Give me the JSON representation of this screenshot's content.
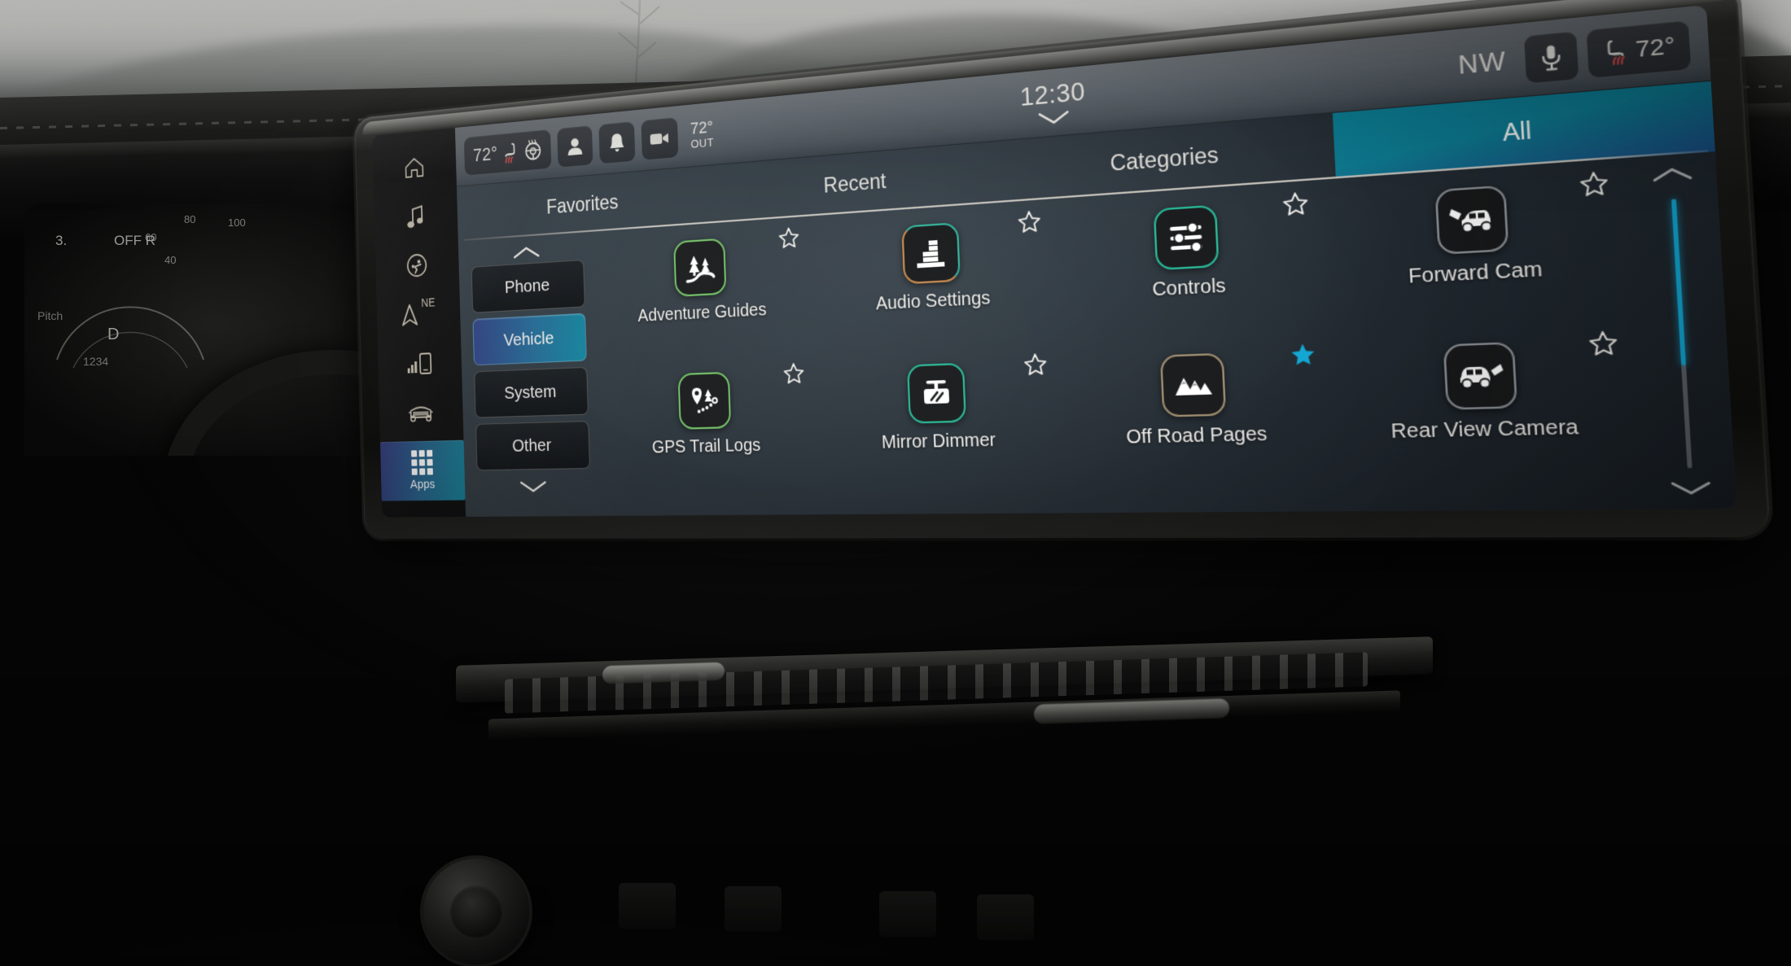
{
  "scene": {
    "description": "Automotive infotainment touchscreen Apps menu, angled view from driver seat",
    "accent_teal": "#0d7e95",
    "accent_cyan": "#12a9d6",
    "accent_blue": "#2e3f83"
  },
  "hardkeys": {
    "items": [
      {
        "name": "home",
        "icon": "home-icon",
        "label": ""
      },
      {
        "name": "media",
        "icon": "music-note-icon",
        "label": ""
      },
      {
        "name": "comfort",
        "icon": "comfort-person-icon",
        "label": ""
      },
      {
        "name": "navigation",
        "icon": "nav-arrow-icon",
        "label": "NE"
      },
      {
        "name": "phone",
        "icon": "phone-signal-icon",
        "label": ""
      },
      {
        "name": "vehicle",
        "icon": "vehicle-front-icon",
        "label": ""
      },
      {
        "name": "apps",
        "icon": "apps-grid-icon",
        "label": "Apps"
      }
    ],
    "selected": "apps"
  },
  "statusbar": {
    "driver_temp": "72°",
    "heated_seat_icon": "heated-seat-icon",
    "heated_wheel_icon": "heated-steering-wheel-icon",
    "profile_icon": "user-profile-icon",
    "notifications_icon": "bell-icon",
    "camera_icon": "camera-icon",
    "outside_temp": "72°",
    "outside_label": "OUT",
    "clock": "12:30",
    "clock_chevron_icon": "chevron-down-icon",
    "heading": "NW",
    "mic_icon": "microphone-icon",
    "passenger_heated_seat_icon": "heated-seat-icon",
    "passenger_temp": "72°"
  },
  "tabs": [
    {
      "label": "Favorites",
      "active": false
    },
    {
      "label": "Recent",
      "active": false
    },
    {
      "label": "Categories",
      "active": false
    },
    {
      "label": "All",
      "active": true
    }
  ],
  "categories": {
    "scroll_up_icon": "chevron-up-icon",
    "scroll_down_icon": "chevron-down-icon",
    "items": [
      {
        "label": "Phone",
        "active": false
      },
      {
        "label": "Vehicle",
        "active": true
      },
      {
        "label": "System",
        "active": false
      },
      {
        "label": "Other",
        "active": false
      }
    ]
  },
  "apps": {
    "rows": [
      [
        {
          "label": "Adventure Guides",
          "icon": "trail-trees-icon",
          "border": "green",
          "favorited": false
        },
        {
          "label": "Audio Settings",
          "icon": "equalizer-bars-icon",
          "border": "orange",
          "favorited": false
        },
        {
          "label": "Controls",
          "icon": "sliders-icon",
          "border": "teal",
          "favorited": false
        },
        {
          "label": "Forward Cam",
          "icon": "forward-camera-truck-icon",
          "border": "gray",
          "favorited": false
        }
      ],
      [
        {
          "label": "GPS Trail Logs",
          "icon": "gps-trail-pin-icon",
          "border": "green",
          "favorited": false
        },
        {
          "label": "Mirror Dimmer",
          "icon": "mirror-dimmer-icon",
          "border": "teal",
          "favorited": false
        },
        {
          "label": "Off Road Pages",
          "icon": "mountains-icon",
          "border": "tan",
          "favorited": true
        },
        {
          "label": "Rear View Camera",
          "icon": "rear-camera-truck-icon",
          "border": "gray",
          "favorited": false
        }
      ]
    ]
  },
  "scrollbar": {
    "up_icon": "chevron-up-icon",
    "down_icon": "chevron-down-icon",
    "thumb_position": "top"
  },
  "cluster": {
    "gear": "3.",
    "mode": "OFF R",
    "pitch_label": "Pitch",
    "drive": "D",
    "odometer": "1234",
    "ticks": [
      "40",
      "60",
      "80",
      "100"
    ]
  }
}
